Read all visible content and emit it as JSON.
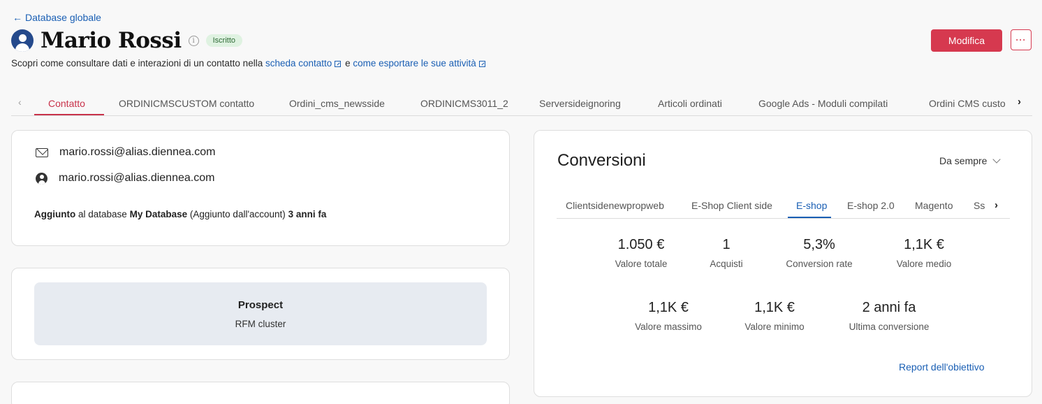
{
  "nav": {
    "back_label": "Database globale"
  },
  "header": {
    "title": "Mario Rossi",
    "status": "Iscritto",
    "edit_label": "Modifica",
    "more_label": "···",
    "subtitle": {
      "prefix": "Scopri come consultare dati e interazioni di un contatto nella",
      "link1": "scheda contatto",
      "middle": "e",
      "link2": "come esportare le sue attività"
    }
  },
  "tabs": [
    {
      "label": "Contatto",
      "active": true
    },
    {
      "label": "ORDINICMSCUSTOM contatto"
    },
    {
      "label": "Ordini_cms_newsside"
    },
    {
      "label": "ORDINICMS3011_2"
    },
    {
      "label": "Serversideignoring"
    },
    {
      "label": "Articoli ordinati"
    },
    {
      "label": "Google Ads - Moduli compilati"
    },
    {
      "label": "Ordini CMS custo"
    }
  ],
  "contact": {
    "email": "mario.rossi@alias.diennea.com",
    "username": "mario.rossi@alias.diennea.com",
    "added": {
      "w1": "Aggiunto",
      "t1": "al database",
      "w2": "My Database",
      "t2": "(Aggiunto dall'account)",
      "w3": "3 anni fa"
    }
  },
  "rfm": {
    "title": "Prospect",
    "subtitle": "RFM cluster"
  },
  "conversions": {
    "title": "Conversioni",
    "period": "Da sempre",
    "tabs": [
      {
        "label": "Clientsidenewpropweb"
      },
      {
        "label": "E-Shop Client side"
      },
      {
        "label": "E-shop",
        "active": true
      },
      {
        "label": "E-shop 2.0"
      },
      {
        "label": "Magento"
      },
      {
        "label": "Ss"
      }
    ],
    "metrics": [
      {
        "value": "1.050 €",
        "label": "Valore totale"
      },
      {
        "value": "1",
        "label": "Acquisti"
      },
      {
        "value": "5,3%",
        "label": "Conversion rate"
      },
      {
        "value": "1,1K €",
        "label": "Valore medio"
      },
      {
        "value": "1,1K €",
        "label": "Valore massimo"
      },
      {
        "value": "1,1K €",
        "label": "Valore minimo"
      },
      {
        "value": "2 anni fa",
        "label": "Ultima conversione"
      }
    ],
    "report_link": "Report dell'obiettivo"
  },
  "colors": {
    "accent": "#d6394f",
    "link": "#1a5fb4",
    "badge_bg": "#dff2e1"
  }
}
